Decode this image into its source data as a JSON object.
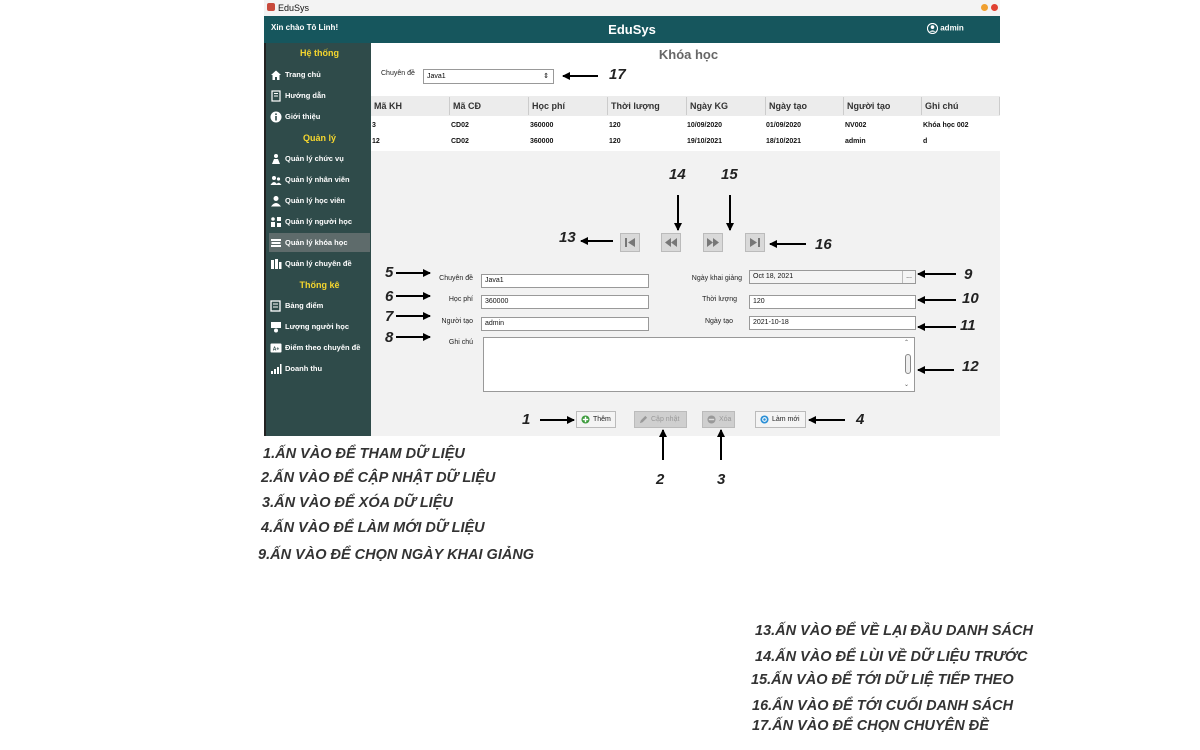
{
  "window": {
    "title": "EduSys"
  },
  "header": {
    "greeting": "Xin chào Tô Linh!",
    "app_title": "EduSys",
    "user": "admin"
  },
  "sidebar": {
    "sections": [
      "Hệ thống",
      "Quản lý",
      "Thống kê"
    ],
    "system_items": [
      {
        "label": "Trang chủ",
        "icon": "home-icon"
      },
      {
        "label": "Hướng dẫn",
        "icon": "book-icon"
      },
      {
        "label": "Giới thiệu",
        "icon": "info-icon"
      }
    ],
    "manage_items": [
      {
        "label": "Quản lý chức vụ",
        "icon": "position-icon"
      },
      {
        "label": "Quản lý nhân viên",
        "icon": "staff-icon"
      },
      {
        "label": "Quản lý học viên",
        "icon": "student-icon"
      },
      {
        "label": "Quản lý người học",
        "icon": "learner-icon"
      },
      {
        "label": "Quản lý khóa học",
        "icon": "course-icon",
        "active": true
      },
      {
        "label": "Quản lý chuyên đề",
        "icon": "topic-icon"
      }
    ],
    "stats_items": [
      {
        "label": "Bảng điểm",
        "icon": "scoreboard-icon"
      },
      {
        "label": "Lượng người học",
        "icon": "learner-count-icon"
      },
      {
        "label": "Điểm theo chuyên đề",
        "icon": "topic-score-icon"
      },
      {
        "label": "Doanh thu",
        "icon": "revenue-icon"
      }
    ]
  },
  "main": {
    "title": "Khóa học",
    "topic_filter": {
      "label": "Chuyên đề",
      "value": "Java1"
    },
    "table": {
      "columns": [
        "Mã KH",
        "Mã CĐ",
        "Học phí",
        "Thời lượng",
        "Ngày KG",
        "Ngày tạo",
        "Người tạo",
        "Ghi chú"
      ],
      "rows": [
        [
          "3",
          "CD02",
          "360000",
          "120",
          "10/09/2020",
          "01/09/2020",
          "NV002",
          "Khóa học 002"
        ],
        [
          "12",
          "CD02",
          "360000",
          "120",
          "19/10/2021",
          "18/10/2021",
          "admin",
          "d"
        ]
      ]
    },
    "form": {
      "topic_label": "Chuyên đề",
      "topic_value": "Java1",
      "fee_label": "Học phí",
      "fee_value": "360000",
      "creator_label": "Người tạo",
      "creator_value": "admin",
      "note_label": "Ghi chú",
      "note_value": "",
      "start_label": "Ngày khai giảng",
      "start_value": "Oct 18, 2021",
      "start_picker": "...",
      "duration_label": "Thời lượng",
      "duration_value": "120",
      "created_label": "Ngày tạo",
      "created_value": "2021-10-18"
    },
    "buttons": {
      "add": "Thêm",
      "update": "Cập nhật",
      "delete": "Xóa",
      "reset": "Làm mới"
    }
  },
  "annotations": {
    "numbers": [
      "1",
      "2",
      "3",
      "4",
      "5",
      "6",
      "7",
      "8",
      "9",
      "10",
      "11",
      "12",
      "13",
      "14",
      "15",
      "16",
      "17"
    ],
    "notes": [
      "1.ẤN VÀO ĐỂ THAM DỮ LIỆU",
      "2.ẤN VÀO ĐỂ CẬP NHẬT DỮ LIỆU",
      "3.ẤN VÀO ĐỂ XÓA DỮ LIỆU",
      "4.ẤN VÀO ĐỂ LÀM MỚI DỮ LIỆU",
      "9.ẤN VÀO ĐỂ CHỌN NGÀY KHAI GIẢNG",
      "13.ẤN VÀO ĐỂ  VỀ LẠI ĐẦU DANH SÁCH",
      "14.ẤN VÀO ĐỂ LÙI VỀ  DỮ LIỆU TRƯỚC",
      "15.ẤN VÀO ĐỂ TỚI DỮ LIỆ TIẾP THEO",
      "16.ẤN VÀO ĐỂ TỚI CUỐI DANH SÁCH",
      "17.ẤN VÀO ĐỂ CHỌN CHUYÊN ĐỀ"
    ]
  },
  "colors": {
    "header": "#16565d",
    "sidebar": "#2f4b4a",
    "section": "#f5d62e",
    "active_item": "#5e6b6b"
  }
}
